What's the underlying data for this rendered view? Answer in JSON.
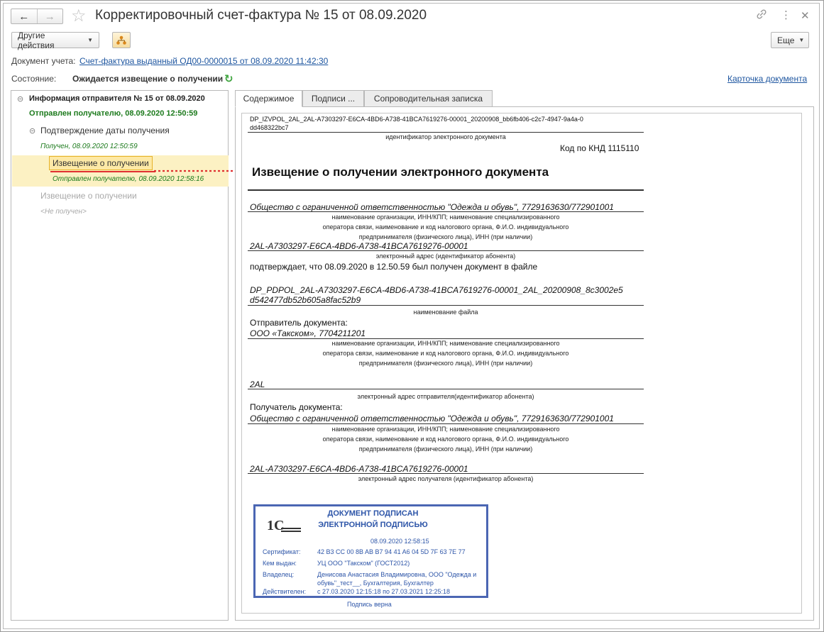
{
  "window": {
    "title": "Корректировочный счет-фактура № 15 от 08.09.2020",
    "icons": [
      "arrow-left-icon",
      "arrow-right-icon",
      "star-icon",
      "link-icon",
      "kebab-menu-icon",
      "close-icon"
    ]
  },
  "toolbar": {
    "other_actions": "Другие действия",
    "more": "Еще"
  },
  "header": {
    "account_doc_label": "Документ учета:",
    "account_doc_link": "Счет-фактура выданный ОД00-0000015 от 08.09.2020 11:42:30",
    "state_label": "Состояние:",
    "state_value": "Ожидается извещение о получении",
    "card_link": "Карточка документа"
  },
  "tree": {
    "root": "Информация отправителя № 15 от 08.09.2020",
    "root_status": "Отправлен получателю, 08.09.2020 12:50:59",
    "confirm": "Подтверждение даты получения",
    "confirm_status": "Получен, 08.09.2020 12:50:59",
    "notice1": "Извещение о получении",
    "notice1_status": "Отправлен получателю, 08.09.2020 12:58:16",
    "notice2": "Извещение о получении",
    "notice2_status": "<Не получен>"
  },
  "tabs": [
    "Содержимое",
    "Подписи ...",
    "Сопроводительная записка"
  ],
  "document": {
    "id_line1": "DP_IZVPOL_2AL_2AL-A7303297-E6CA-4BD6-A738-41BCA7619276-00001_20200908_bb6fb406-c2c7-4947-9a4a-0",
    "id_line2": "dd468322bc7",
    "id_caption": "идентификатор электронного документа",
    "knd": "Код по КНД 1115110",
    "heading": "Извещение о получении электронного документа",
    "org": "Общество с ограниченной ответственностью \"Одежда и обувь\", 7729163630/772901001",
    "org_cap1": "наименование организации, ИНН/КПП; наименование специализированного",
    "org_cap2": "оператора связи, наименование и код налогового органа, Ф.И.О. индивидуального",
    "org_cap3": "предпринимателя (физического лица), ИНН (при наличии)",
    "address": "2AL-A7303297-E6CA-4BD6-A738-41BCA7619276-00001",
    "address_cap": "электронный адрес (идентификатор абонента)",
    "confirms": "подтверждает, что 08.09.2020 в 12.50.59 был получен документ в файле",
    "file1": "DP_PDPOL_2AL-A7303297-E6CA-4BD6-A738-41BCA7619276-00001_2AL_20200908_8c3002e5",
    "file2": "d542477db52b605a8fac52b9",
    "file_cap": "наименование файла",
    "sender_label": "Отправитель документа:",
    "sender": "ООО «Такском», 7704211201",
    "sender_cap1": "наименование организации, ИНН/КПП; наименование специализированного",
    "sender_cap2": "оператора связи, наименование и код налогового органа, Ф.И.О. индивидуального",
    "sender_cap3": "предпринимателя (физического лица), ИНН (при наличии)",
    "sender_addr": "2AL",
    "sender_addr_cap": "электронный адрес отправителя(идентификатор абонента)",
    "receiver_label": "Получатель документа:",
    "receiver": "Общество с ограниченной ответственностью \"Одежда и обувь\", 7729163630/772901001",
    "receiver_cap1": "наименование организации, ИНН/КПП; наименование специализированного",
    "receiver_cap2": "оператора связи, наименование и код налогового органа, Ф.И.О. индивидуального",
    "receiver_cap3": "предпринимателя (физического лица), ИНН (при наличии)",
    "receiver_addr": "2AL-A7303297-E6CA-4BD6-A738-41BCA7619276-00001",
    "receiver_addr_cap": "электронный адрес получателя (идентификатор абонента)"
  },
  "signature": {
    "logo": "1С",
    "title1": "ДОКУМЕНТ ПОДПИСАН",
    "title2": "ЭЛЕКТРОННОЙ ПОДПИСЬЮ",
    "date": "08.09.2020 12:58:15",
    "cert_label": "Сертификат:",
    "cert_value": "42 B3 CC 00 8B AB B7 94 41 A6 04 5D 7F 63 7E 77",
    "issuer_label": "Кем выдан:",
    "issuer_value": "УЦ ООО \"Такском\" (ГОСТ2012)",
    "owner_label": "Владелец:",
    "owner_value1": "Денисова Анастасия Владимировна, ООО \"Одежда и",
    "owner_value2": "обувь\"_тест__, Бухгалтерия, Бухгалтер",
    "valid_label": "Действителен:",
    "valid_value": "с 27.03.2020 12:15:18 по 27.03.2021 12:25:18",
    "verified": "Подпись верна"
  },
  "colors": {
    "link": "#1e56a0",
    "status_green": "#1c7a1c",
    "highlight": "#fcf1c3",
    "signature_blue": "#4b66b3",
    "annotation_red": "#e03030"
  }
}
